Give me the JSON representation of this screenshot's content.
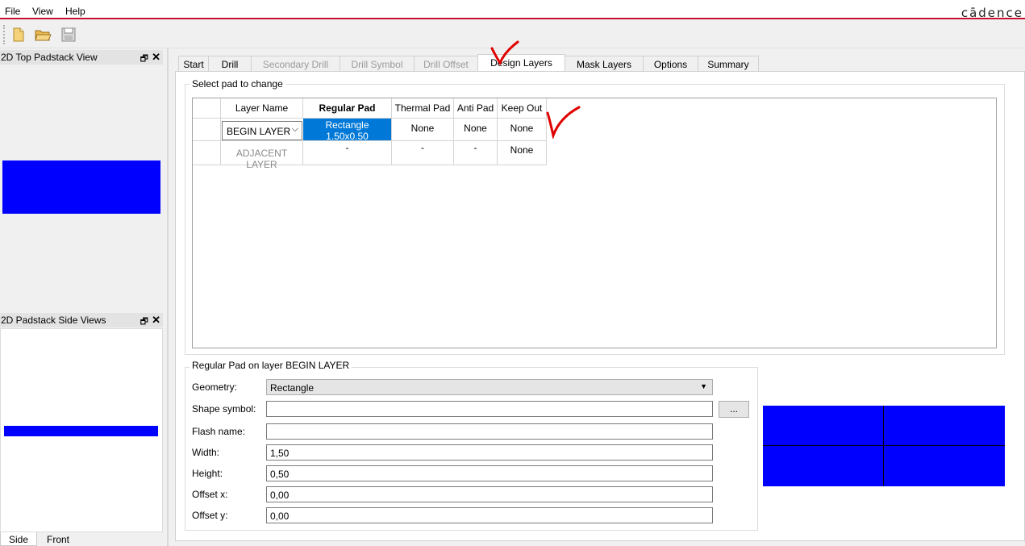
{
  "menu": [
    "File",
    "View",
    "Help"
  ],
  "logo": "cādence",
  "toolbar": {
    "icons": [
      "new-file-icon",
      "open-folder-icon",
      "save-icon"
    ]
  },
  "docks": {
    "top": {
      "title": "2D Top Padstack View"
    },
    "side": {
      "title": "2D Padstack Side Views",
      "tabs": [
        "Side",
        "Front"
      ]
    },
    "float_glyph": "🗗",
    "close_glyph": "✕"
  },
  "tabs": [
    "Start",
    "Drill",
    "Secondary Drill",
    "Drill Symbol",
    "Drill Offset",
    "Design Layers",
    "Mask Layers",
    "Options",
    "Summary"
  ],
  "active_tab": "Design Layers",
  "disabled_tabs": [
    "Secondary Drill",
    "Drill Symbol",
    "Drill Offset"
  ],
  "pad_group": {
    "title": "Select pad to change",
    "headers": [
      "Layer Name",
      "Regular Pad",
      "Thermal Pad",
      "Anti Pad",
      "Keep Out"
    ],
    "rows": [
      {
        "layer": "BEGIN LAYER",
        "regular": "Rectangle 1.50x0.50",
        "thermal": "None",
        "anti": "None",
        "keepout": "None"
      },
      {
        "layer": "ADJACENT LAYER",
        "regular": "-",
        "thermal": "-",
        "anti": "-",
        "keepout": "None"
      }
    ]
  },
  "props": {
    "title": "Regular Pad on layer BEGIN LAYER",
    "geometry_label": "Geometry:",
    "geometry_value": "Rectangle",
    "shape_symbol_label": "Shape symbol:",
    "shape_symbol_value": "",
    "browse_label": "...",
    "flash_name_label": "Flash name:",
    "flash_name_value": "",
    "width_label": "Width:",
    "width_value": "1,50",
    "height_label": "Height:",
    "height_value": "0,50",
    "offset_x_label": "Offset x:",
    "offset_x_value": "0,00",
    "offset_y_label": "Offset y:",
    "offset_y_value": "0,00"
  },
  "colors": {
    "pad": "#0000ff",
    "selection": "#0078d7",
    "accent_line": "#c8102e",
    "annotation": "#e00000"
  }
}
